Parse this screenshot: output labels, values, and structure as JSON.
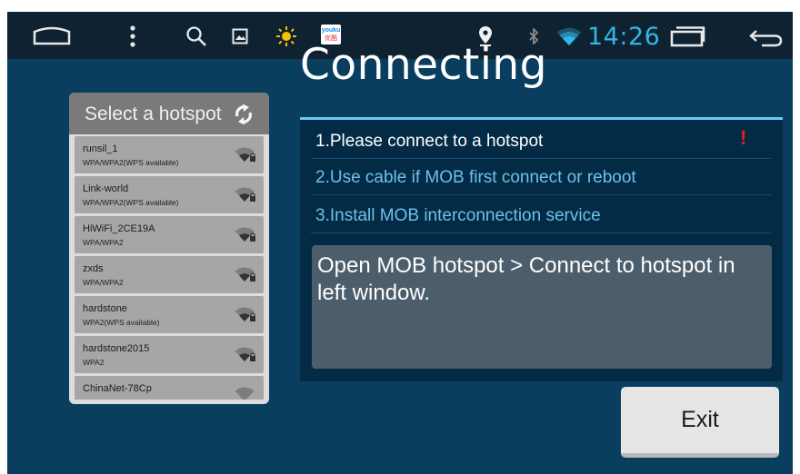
{
  "status_bar": {
    "time": "14:26",
    "icons": [
      "home-icon",
      "menu-dots-icon",
      "search-icon",
      "gallery-icon",
      "brightness-icon",
      "youku-app-icon",
      "location-icon",
      "bluetooth-icon",
      "wifi-icon",
      "recent-apps-icon",
      "back-icon"
    ],
    "app_badge_text": [
      "youku",
      "优酷"
    ],
    "accent_color": "#33b5e5"
  },
  "page": {
    "title": "Connecting"
  },
  "hotspot_panel": {
    "title": "Select a hotspot",
    "refresh_icon": "refresh-icon",
    "items": [
      {
        "name": "runsil_1",
        "security": "WPA/WPA2(WPS available)"
      },
      {
        "name": "Link-world",
        "security": "WPA/WPA2(WPS available)"
      },
      {
        "name": "HiWiFi_2CE19A",
        "security": "WPA/WPA2"
      },
      {
        "name": "zxds",
        "security": "WPA/WPA2"
      },
      {
        "name": "hardstone",
        "security": "WPA2(WPS available)"
      },
      {
        "name": "hardstone2015",
        "security": "WPA2"
      },
      {
        "name": "ChinaNet-78Cp",
        "security": ""
      }
    ]
  },
  "steps": {
    "items": [
      {
        "label": "1.Please connect to a hotspot",
        "color": "#ffffff"
      },
      {
        "label": "2.Use cable if MOB first connect or reboot",
        "color": "#6ec0ea"
      },
      {
        "label": "3.Install MOB interconnection service",
        "color": "#6ec0ea"
      }
    ],
    "alert_mark": "!",
    "alert_color": "#e02020",
    "message": "Open MOB hotspot > Connect to hotspot in left window."
  },
  "actions": {
    "exit_label": "Exit"
  }
}
